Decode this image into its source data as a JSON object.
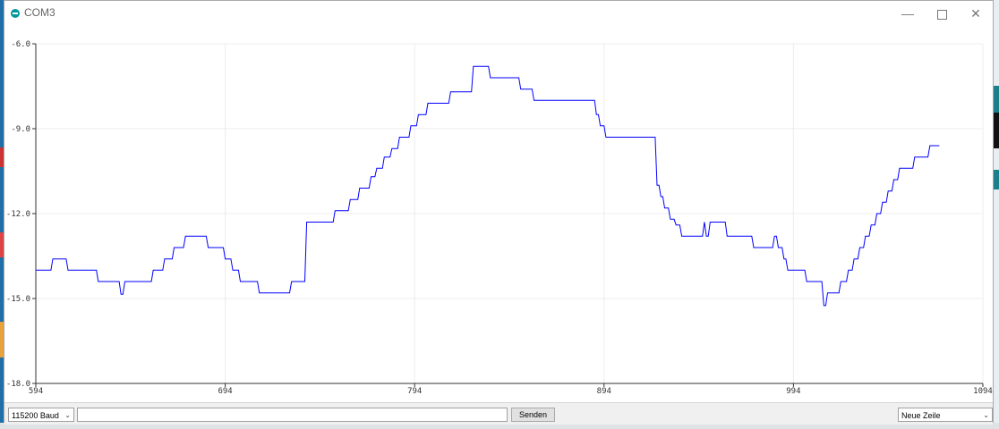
{
  "window": {
    "title": "COM3"
  },
  "controls": {
    "baud": "115200 Baud",
    "send_label": "Senden",
    "send_value": "",
    "line_ending": "Neue Zeile"
  },
  "chart_data": {
    "type": "line",
    "xlim": [
      594,
      1094
    ],
    "ylim": [
      -18,
      -6
    ],
    "x_ticks": [
      "594",
      "694",
      "794",
      "894",
      "994",
      "1094"
    ],
    "y_ticks": [
      "-6.0",
      "-9.0",
      "-12.0",
      "-15.0",
      "-18.0"
    ],
    "grid": true,
    "colors": {
      "series": "#0000ff",
      "grid": "#ececec",
      "axis": "#333333"
    },
    "series": [
      {
        "points": [
          [
            594,
            -14.0
          ],
          [
            602,
            -14.0
          ],
          [
            603,
            -13.6
          ],
          [
            610,
            -13.6
          ],
          [
            611,
            -14.0
          ],
          [
            626,
            -14.0
          ],
          [
            627,
            -14.4
          ],
          [
            638,
            -14.4
          ],
          [
            639,
            -14.85
          ],
          [
            640,
            -14.85
          ],
          [
            641,
            -14.4
          ],
          [
            655,
            -14.4
          ],
          [
            656,
            -14.0
          ],
          [
            661,
            -14.0
          ],
          [
            662,
            -13.6
          ],
          [
            666,
            -13.6
          ],
          [
            667,
            -13.2
          ],
          [
            672,
            -13.2
          ],
          [
            673,
            -12.8
          ],
          [
            684,
            -12.8
          ],
          [
            685,
            -13.2
          ],
          [
            693,
            -13.2
          ],
          [
            694,
            -13.6
          ],
          [
            697,
            -13.6
          ],
          [
            698,
            -14.0
          ],
          [
            701,
            -14.0
          ],
          [
            702,
            -14.4
          ],
          [
            711,
            -14.4
          ],
          [
            712,
            -14.8
          ],
          [
            728,
            -14.8
          ],
          [
            729,
            -14.4
          ],
          [
            736,
            -14.4
          ],
          [
            737,
            -12.3
          ],
          [
            751,
            -12.3
          ],
          [
            752,
            -11.9
          ],
          [
            759,
            -11.9
          ],
          [
            760,
            -11.5
          ],
          [
            764,
            -11.5
          ],
          [
            765,
            -11.1
          ],
          [
            770,
            -11.1
          ],
          [
            771,
            -10.7
          ],
          [
            773,
            -10.7
          ],
          [
            774,
            -10.4
          ],
          [
            777,
            -10.4
          ],
          [
            778,
            -10.0
          ],
          [
            781,
            -10.0
          ],
          [
            782,
            -9.7
          ],
          [
            785,
            -9.7
          ],
          [
            786,
            -9.3
          ],
          [
            791,
            -9.3
          ],
          [
            792,
            -8.9
          ],
          [
            795,
            -8.9
          ],
          [
            796,
            -8.5
          ],
          [
            800,
            -8.5
          ],
          [
            801,
            -8.1
          ],
          [
            812,
            -8.1
          ],
          [
            813,
            -7.7
          ],
          [
            824,
            -7.7
          ],
          [
            825,
            -6.8
          ],
          [
            833,
            -6.8
          ],
          [
            834,
            -7.2
          ],
          [
            849,
            -7.2
          ],
          [
            850,
            -7.6
          ],
          [
            856,
            -7.6
          ],
          [
            857,
            -8.0
          ],
          [
            889,
            -8.0
          ],
          [
            890,
            -8.5
          ],
          [
            891,
            -8.5
          ],
          [
            892,
            -8.9
          ],
          [
            894,
            -8.9
          ],
          [
            895,
            -9.3
          ],
          [
            921,
            -9.3
          ],
          [
            922,
            -11.0
          ],
          [
            923,
            -11.0
          ],
          [
            924,
            -11.4
          ],
          [
            925,
            -11.4
          ],
          [
            926,
            -11.8
          ],
          [
            928,
            -11.8
          ],
          [
            929,
            -12.2
          ],
          [
            931,
            -12.2
          ],
          [
            932,
            -12.4
          ],
          [
            934,
            -12.4
          ],
          [
            935,
            -12.8
          ],
          [
            946,
            -12.8
          ],
          [
            947,
            -12.3
          ],
          [
            948,
            -12.8
          ],
          [
            949,
            -12.8
          ],
          [
            950,
            -12.3
          ],
          [
            958,
            -12.3
          ],
          [
            959,
            -12.8
          ],
          [
            972,
            -12.8
          ],
          [
            973,
            -13.2
          ],
          [
            983,
            -13.2
          ],
          [
            984,
            -12.8
          ],
          [
            985,
            -12.8
          ],
          [
            986,
            -13.2
          ],
          [
            988,
            -13.2
          ],
          [
            989,
            -13.6
          ],
          [
            990,
            -13.6
          ],
          [
            991,
            -14.0
          ],
          [
            1000,
            -14.0
          ],
          [
            1001,
            -14.4
          ],
          [
            1009,
            -14.4
          ],
          [
            1010,
            -15.25
          ],
          [
            1011,
            -15.25
          ],
          [
            1012,
            -14.8
          ],
          [
            1018,
            -14.8
          ],
          [
            1019,
            -14.4
          ],
          [
            1022,
            -14.4
          ],
          [
            1023,
            -14.0
          ],
          [
            1025,
            -14.0
          ],
          [
            1026,
            -13.6
          ],
          [
            1028,
            -13.6
          ],
          [
            1029,
            -13.2
          ],
          [
            1031,
            -13.2
          ],
          [
            1032,
            -12.8
          ],
          [
            1034,
            -12.8
          ],
          [
            1035,
            -12.4
          ],
          [
            1037,
            -12.4
          ],
          [
            1038,
            -12.0
          ],
          [
            1040,
            -12.0
          ],
          [
            1041,
            -11.6
          ],
          [
            1043,
            -11.6
          ],
          [
            1044,
            -11.2
          ],
          [
            1046,
            -11.2
          ],
          [
            1047,
            -10.8
          ],
          [
            1049,
            -10.8
          ],
          [
            1050,
            -10.4
          ],
          [
            1057,
            -10.4
          ],
          [
            1058,
            -10.0
          ],
          [
            1065,
            -10.0
          ],
          [
            1066,
            -9.6
          ],
          [
            1071,
            -9.6
          ]
        ]
      }
    ]
  }
}
